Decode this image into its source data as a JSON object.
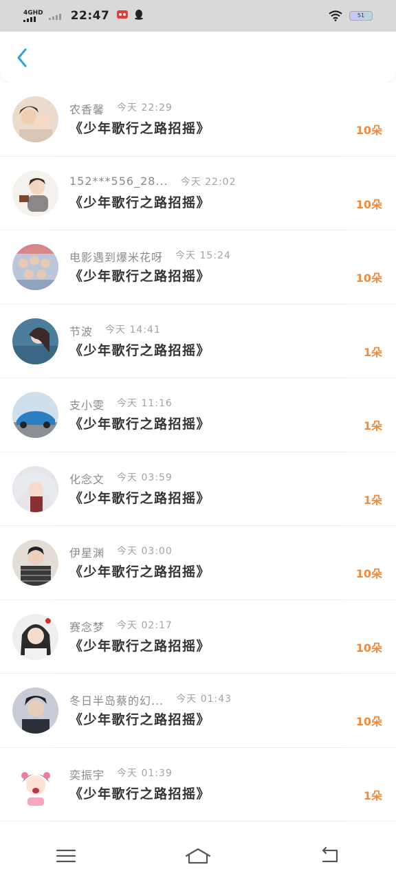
{
  "status_bar": {
    "network": "4GHD",
    "time": "22:47",
    "battery": "51",
    "icons": [
      "signal-icon",
      "app-notification-icon",
      "qq-icon",
      "wifi-icon",
      "battery-icon"
    ]
  },
  "header": {
    "back_icon": "chevron-left-icon",
    "accent_color": "#2f9fe0"
  },
  "list": {
    "items": [
      {
        "name": "农香馨",
        "time": "今天 22:29",
        "song": "《少年歌行之路招摇》",
        "count": "10朵"
      },
      {
        "name": "152***556_28...",
        "time": "今天 22:02",
        "song": "《少年歌行之路招摇》",
        "count": "10朵"
      },
      {
        "name": "电影遇到爆米花呀",
        "time": "今天 15:24",
        "song": "《少年歌行之路招摇》",
        "count": "10朵"
      },
      {
        "name": "节波",
        "time": "今天 14:41",
        "song": "《少年歌行之路招摇》",
        "count": "1朵"
      },
      {
        "name": "支小雯",
        "time": "今天 11:16",
        "song": "《少年歌行之路招摇》",
        "count": "1朵"
      },
      {
        "name": "化念文",
        "time": "今天 03:59",
        "song": "《少年歌行之路招摇》",
        "count": "1朵"
      },
      {
        "name": "伊星渊",
        "time": "今天 03:00",
        "song": "《少年歌行之路招摇》",
        "count": "10朵"
      },
      {
        "name": "赛念梦",
        "time": "今天 02:17",
        "song": "《少年歌行之路招摇》",
        "count": "10朵"
      },
      {
        "name": "冬日半岛蔡的幻...",
        "time": "今天 01:43",
        "song": "《少年歌行之路招摇》",
        "count": "10朵"
      },
      {
        "name": "奕振宇",
        "time": "今天 01:39",
        "song": "《少年歌行之路招摇》",
        "count": "1朵"
      }
    ],
    "count_color": "#f08a3c"
  },
  "nav_bar": {
    "icons": [
      "menu-icon",
      "home-icon",
      "back-icon"
    ]
  }
}
